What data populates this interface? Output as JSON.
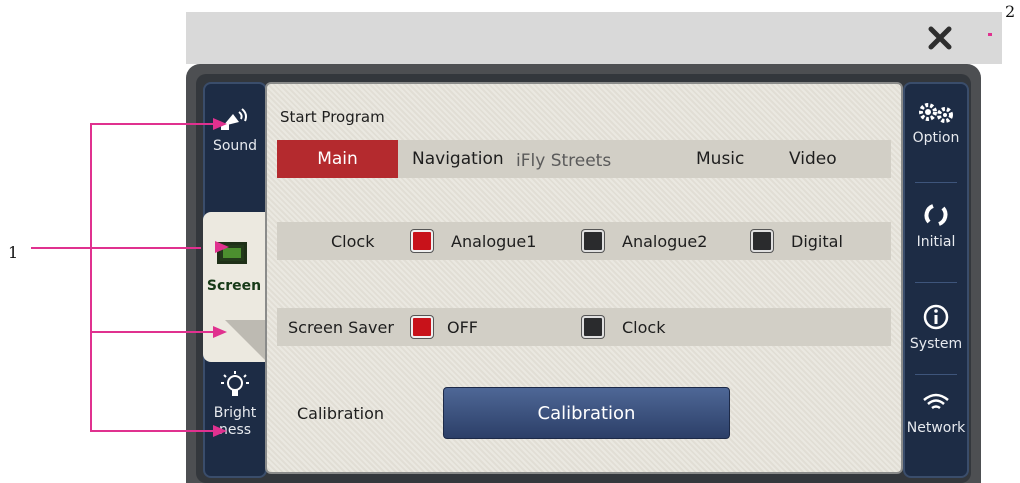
{
  "callouts": {
    "one": "1",
    "two": "2"
  },
  "left_sidebar": {
    "items": [
      {
        "label": "Sound",
        "icon": "speaker-icon"
      },
      {
        "label": "Screen",
        "icon": "screen-icon",
        "selected": true
      },
      {
        "label": "Bright\nness",
        "icon": "bulb-icon"
      }
    ]
  },
  "right_sidebar": {
    "items": [
      {
        "label": "Option",
        "icon": "gears-icon"
      },
      {
        "label": "Initial",
        "icon": "refresh-icon"
      },
      {
        "label": "System",
        "icon": "info-icon"
      },
      {
        "label": "Network",
        "icon": "wifi-icon"
      }
    ]
  },
  "start_program": {
    "title": "Start Program",
    "options": [
      "Main",
      "Navigation",
      "iFly Streets",
      "Music",
      "Video"
    ],
    "selected": "Main"
  },
  "clock": {
    "label": "Clock",
    "options": [
      {
        "label": "Analogue1",
        "checked": true
      },
      {
        "label": "Analogue2",
        "checked": false
      },
      {
        "label": "Digital",
        "checked": false
      }
    ]
  },
  "screen_saver": {
    "label": "Screen Saver",
    "options": [
      {
        "label": "OFF",
        "checked": true
      },
      {
        "label": "Clock",
        "checked": false
      }
    ]
  },
  "calibration": {
    "label": "Calibration",
    "button_label": "Calibration"
  },
  "colors": {
    "accent_red": "#c8121a",
    "sidebar_blue": "#1d2c45",
    "annotation_pink": "#e0318f"
  }
}
